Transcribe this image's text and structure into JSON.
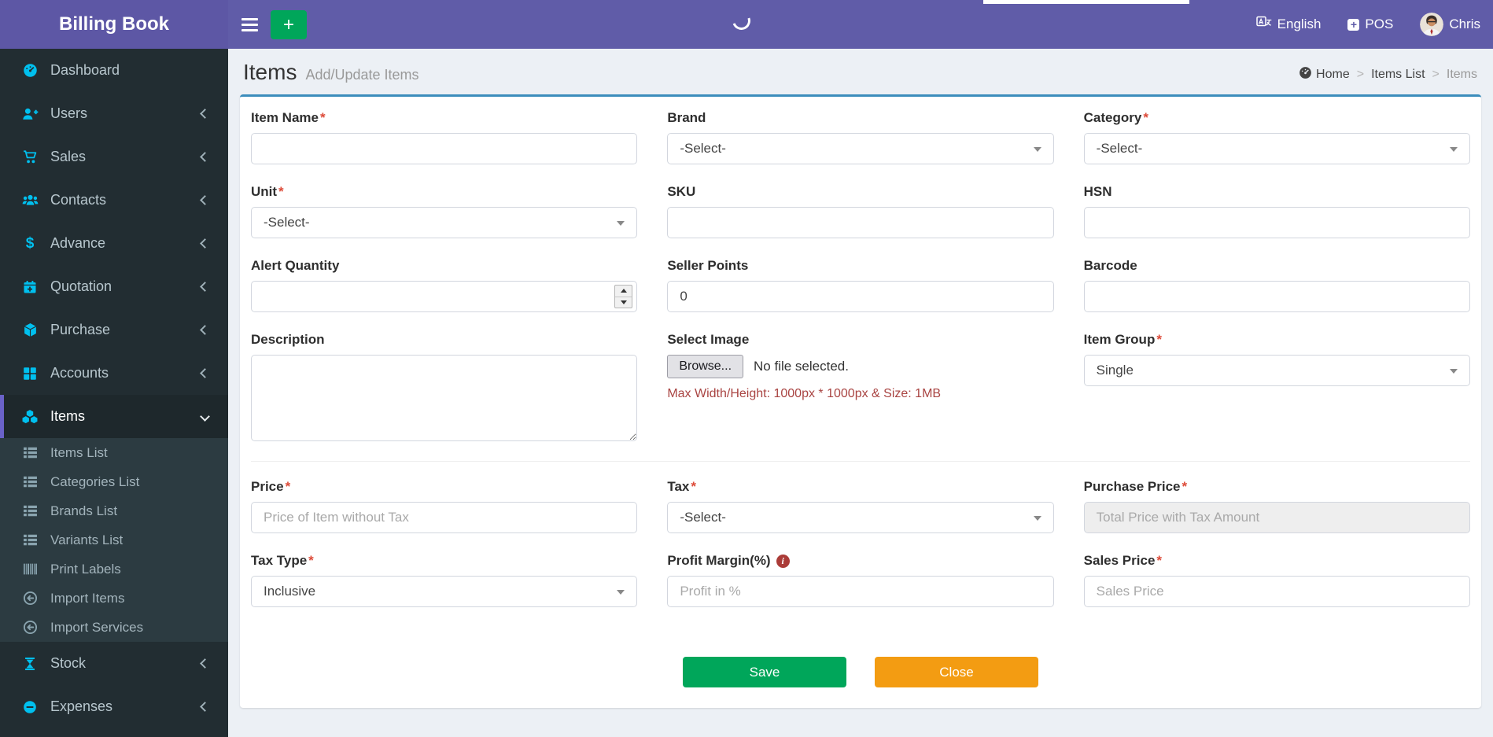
{
  "colors": {
    "navbar_purple": "#605ca8",
    "sidebar_dark": "#222d32",
    "card_top_blue": "#3c8dbc",
    "green": "#00a65a",
    "orange": "#f39c12",
    "icon_cyan": "#00c0ef",
    "note_red": "#a94442",
    "required_red": "#dd4b39"
  },
  "icons": {
    "plus": "+",
    "dollar": "$",
    "info": "i"
  },
  "header": {
    "brand": "Billing Book",
    "language": "English",
    "pos": "POS",
    "user": "Chris"
  },
  "sidebar": {
    "items": [
      {
        "label": "Dashboard"
      },
      {
        "label": "Users"
      },
      {
        "label": "Sales"
      },
      {
        "label": "Contacts"
      },
      {
        "label": "Advance"
      },
      {
        "label": "Quotation"
      },
      {
        "label": "Purchase"
      },
      {
        "label": "Accounts"
      },
      {
        "label": "Items",
        "active": true
      },
      {
        "label": "Stock"
      },
      {
        "label": "Expenses"
      }
    ],
    "subitems": [
      {
        "label": "Items List"
      },
      {
        "label": "Categories List"
      },
      {
        "label": "Brands List"
      },
      {
        "label": "Variants List"
      },
      {
        "label": "Print Labels"
      },
      {
        "label": "Import Items"
      },
      {
        "label": "Import Services"
      }
    ]
  },
  "page": {
    "title": "Items",
    "subtitle": "Add/Update Items"
  },
  "breadcrumb": {
    "separator": ">",
    "items": [
      {
        "label": "Home"
      },
      {
        "label": "Items List"
      },
      {
        "label": "Items"
      }
    ]
  },
  "form": {
    "required_marker": "*",
    "item_name": {
      "label": "Item Name",
      "value": ""
    },
    "brand": {
      "label": "Brand",
      "value": "-Select-"
    },
    "category": {
      "label": "Category",
      "value": "-Select-"
    },
    "unit": {
      "label": "Unit",
      "value": "-Select-"
    },
    "sku": {
      "label": "SKU",
      "value": ""
    },
    "hsn": {
      "label": "HSN",
      "value": ""
    },
    "alert_quantity": {
      "label": "Alert Quantity",
      "value": ""
    },
    "seller_points": {
      "label": "Seller Points",
      "value": "0"
    },
    "barcode": {
      "label": "Barcode",
      "value": ""
    },
    "description": {
      "label": "Description",
      "value": ""
    },
    "select_image": {
      "label": "Select Image",
      "browse_label": "Browse...",
      "no_file_text": "No file selected.",
      "note": "Max Width/Height: 1000px * 1000px & Size: 1MB"
    },
    "item_group": {
      "label": "Item Group",
      "value": "Single"
    },
    "price": {
      "label": "Price",
      "placeholder": "Price of Item without Tax"
    },
    "tax": {
      "label": "Tax",
      "value": "-Select-"
    },
    "purchase_price": {
      "label": "Purchase Price",
      "placeholder": "Total Price with Tax Amount"
    },
    "tax_type": {
      "label": "Tax Type",
      "value": "Inclusive"
    },
    "profit_margin": {
      "label": "Profit Margin(%)",
      "placeholder": "Profit in %"
    },
    "sales_price": {
      "label": "Sales Price",
      "placeholder": "Sales Price"
    },
    "save_label": "Save",
    "close_label": "Close"
  }
}
